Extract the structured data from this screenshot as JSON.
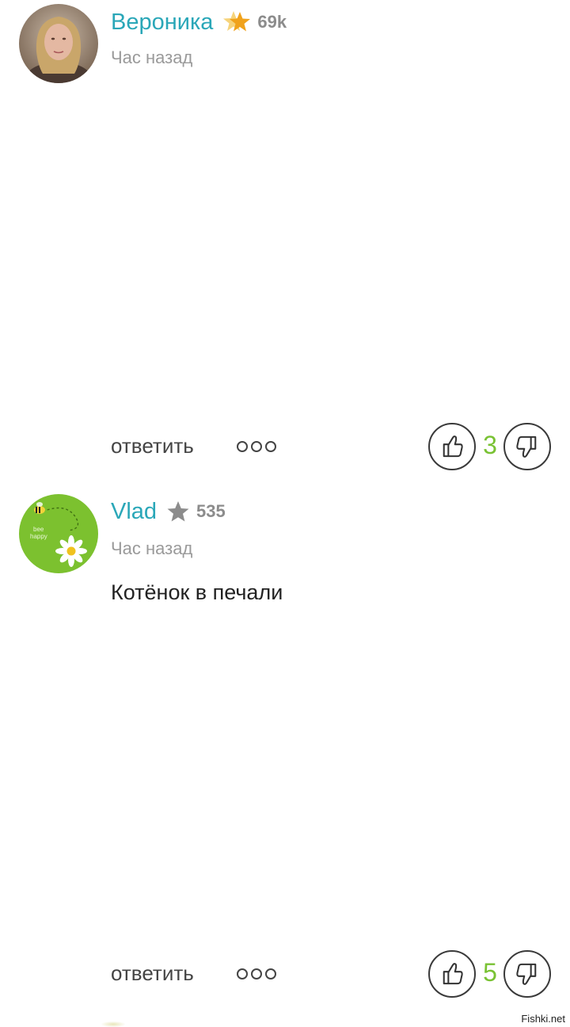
{
  "comments": [
    {
      "username": "Вероника",
      "rank_icon": "gold-star-icon",
      "rating": "69k",
      "timestamp": "Час назад",
      "text": "",
      "reply_label": "ответить",
      "likes": "3"
    },
    {
      "username": "Vlad",
      "rank_icon": "gray-star-icon",
      "rating": "535",
      "timestamp": "Час назад",
      "text": "Котёнок в печали",
      "reply_label": "ответить",
      "likes": "5"
    }
  ],
  "watermark": "Fishki.net",
  "colors": {
    "username": "#2aa7b8",
    "vote_count": "#79c233",
    "rating": "#8c8c8c",
    "timestamp": "#9a9a9a"
  }
}
